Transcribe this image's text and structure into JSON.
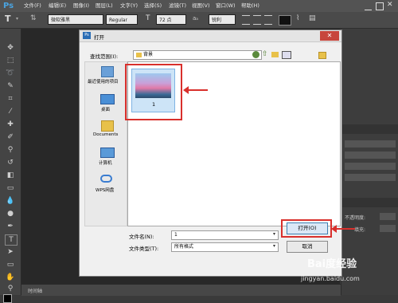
{
  "app": {
    "logo": "Ps",
    "menus": [
      "文件(F)",
      "编辑(E)",
      "图像(I)",
      "图层(L)",
      "文字(Y)",
      "选择(S)",
      "滤镜(T)",
      "视图(V)",
      "窗口(W)",
      "帮助(H)"
    ]
  },
  "options_bar": {
    "font_family": "微软雅黑",
    "font_style": "Regular",
    "font_size": "72 点",
    "antialias": "锐利"
  },
  "right_panel": {
    "field1_label": "不透明度:",
    "field2_label": "填充:"
  },
  "status": {
    "text": "时间轴"
  },
  "dialog": {
    "title": "打开",
    "look_in_label": "查找范围(I):",
    "look_in_value": "背景",
    "places": [
      {
        "label": "最近使用的项目",
        "icon": "recent-places-icon"
      },
      {
        "label": "桌面",
        "icon": "desktop-icon"
      },
      {
        "label": "Documents",
        "icon": "folder-icon"
      },
      {
        "label": "计算机",
        "icon": "computer-icon"
      },
      {
        "label": "WPS网盘",
        "icon": "cloud-icon"
      }
    ],
    "file": {
      "name": "1"
    },
    "filename_label": "文件名(N):",
    "filename_value": "1",
    "filetype_label": "文件类型(T):",
    "filetype_value": "所有格式",
    "open_button": "打开(O)",
    "cancel_button": "取消"
  },
  "watermark": {
    "brand": "Bai度经验",
    "url": "jingyan.baidu.com"
  },
  "colors": {
    "highlight": "#d9302c",
    "ps_blue": "#4aa3df"
  }
}
